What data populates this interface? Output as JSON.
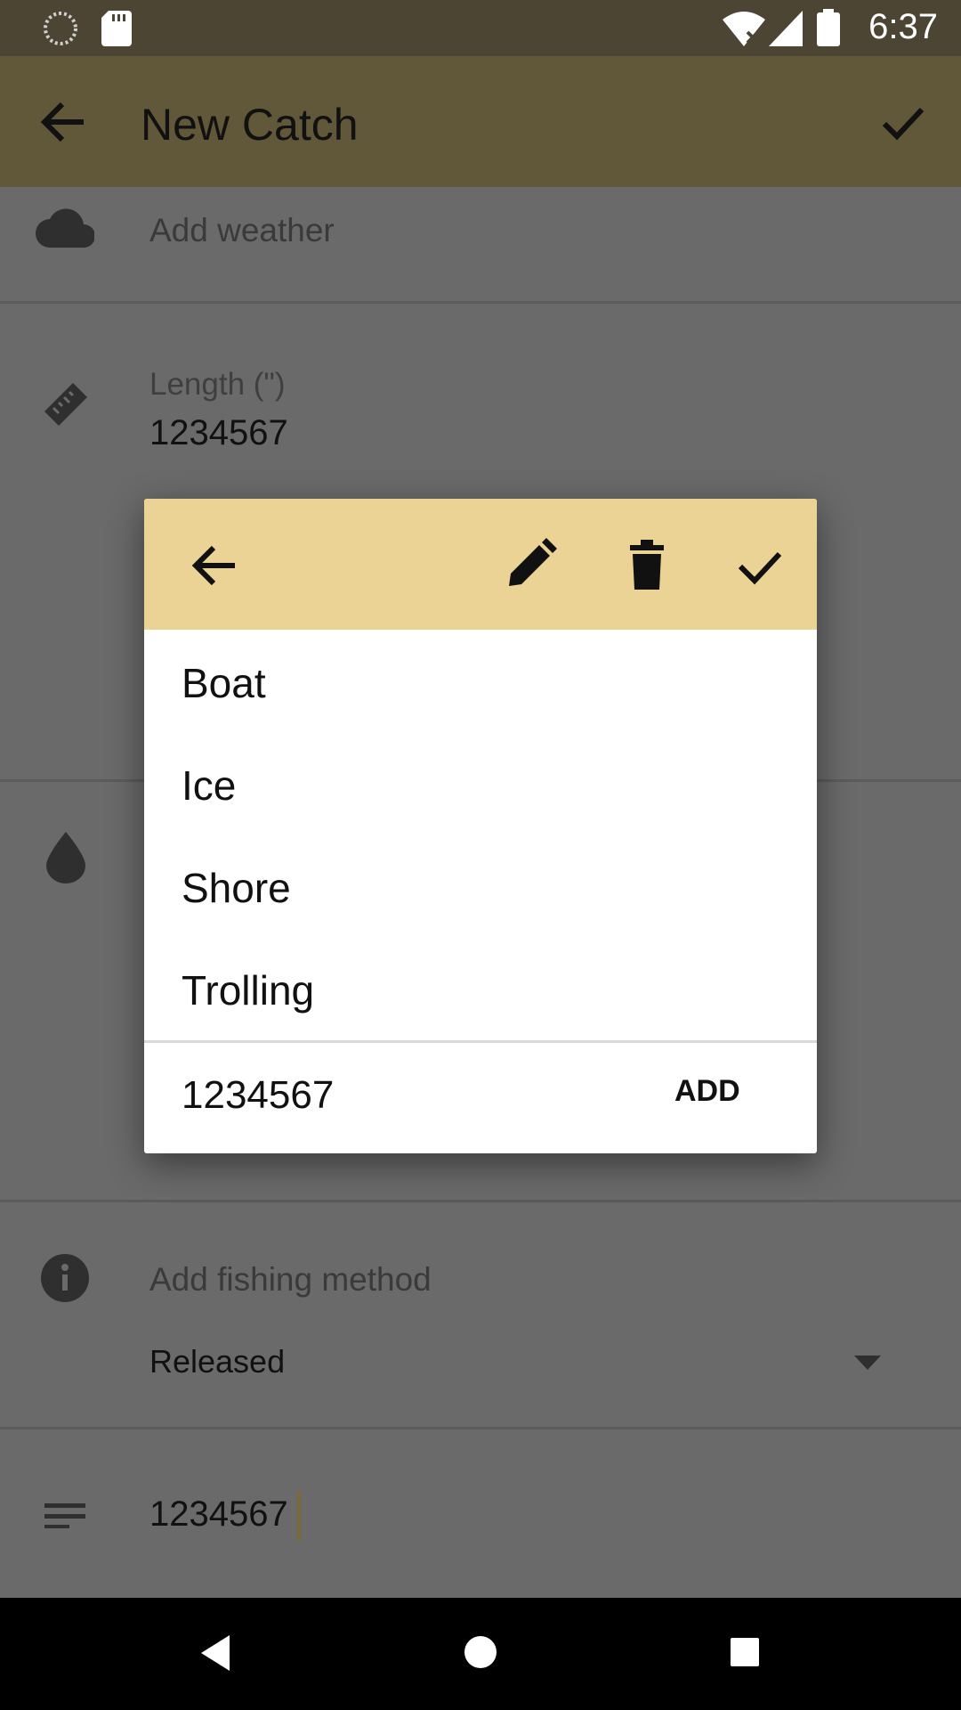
{
  "status_bar": {
    "time": "6:37"
  },
  "app_bar": {
    "title": "New Catch"
  },
  "form": {
    "weather": {
      "hint": "Add weather"
    },
    "length": {
      "label": "Length (\")",
      "value": "1234567"
    },
    "fishing_method": {
      "hint": "Add fishing method"
    },
    "catch_status": {
      "selected": "Released"
    },
    "notes": {
      "value": "1234567"
    }
  },
  "dialog": {
    "items": [
      {
        "label": "Boat"
      },
      {
        "label": "Ice"
      },
      {
        "label": "Shore"
      },
      {
        "label": "Trolling"
      }
    ],
    "input_value": "1234567",
    "add_label": "ADD"
  },
  "colors": {
    "app_bar": "#615739",
    "status_bar": "#4c4534",
    "dialog_toolbar": "#ead394",
    "scrim_background": "#6a6a6a"
  }
}
